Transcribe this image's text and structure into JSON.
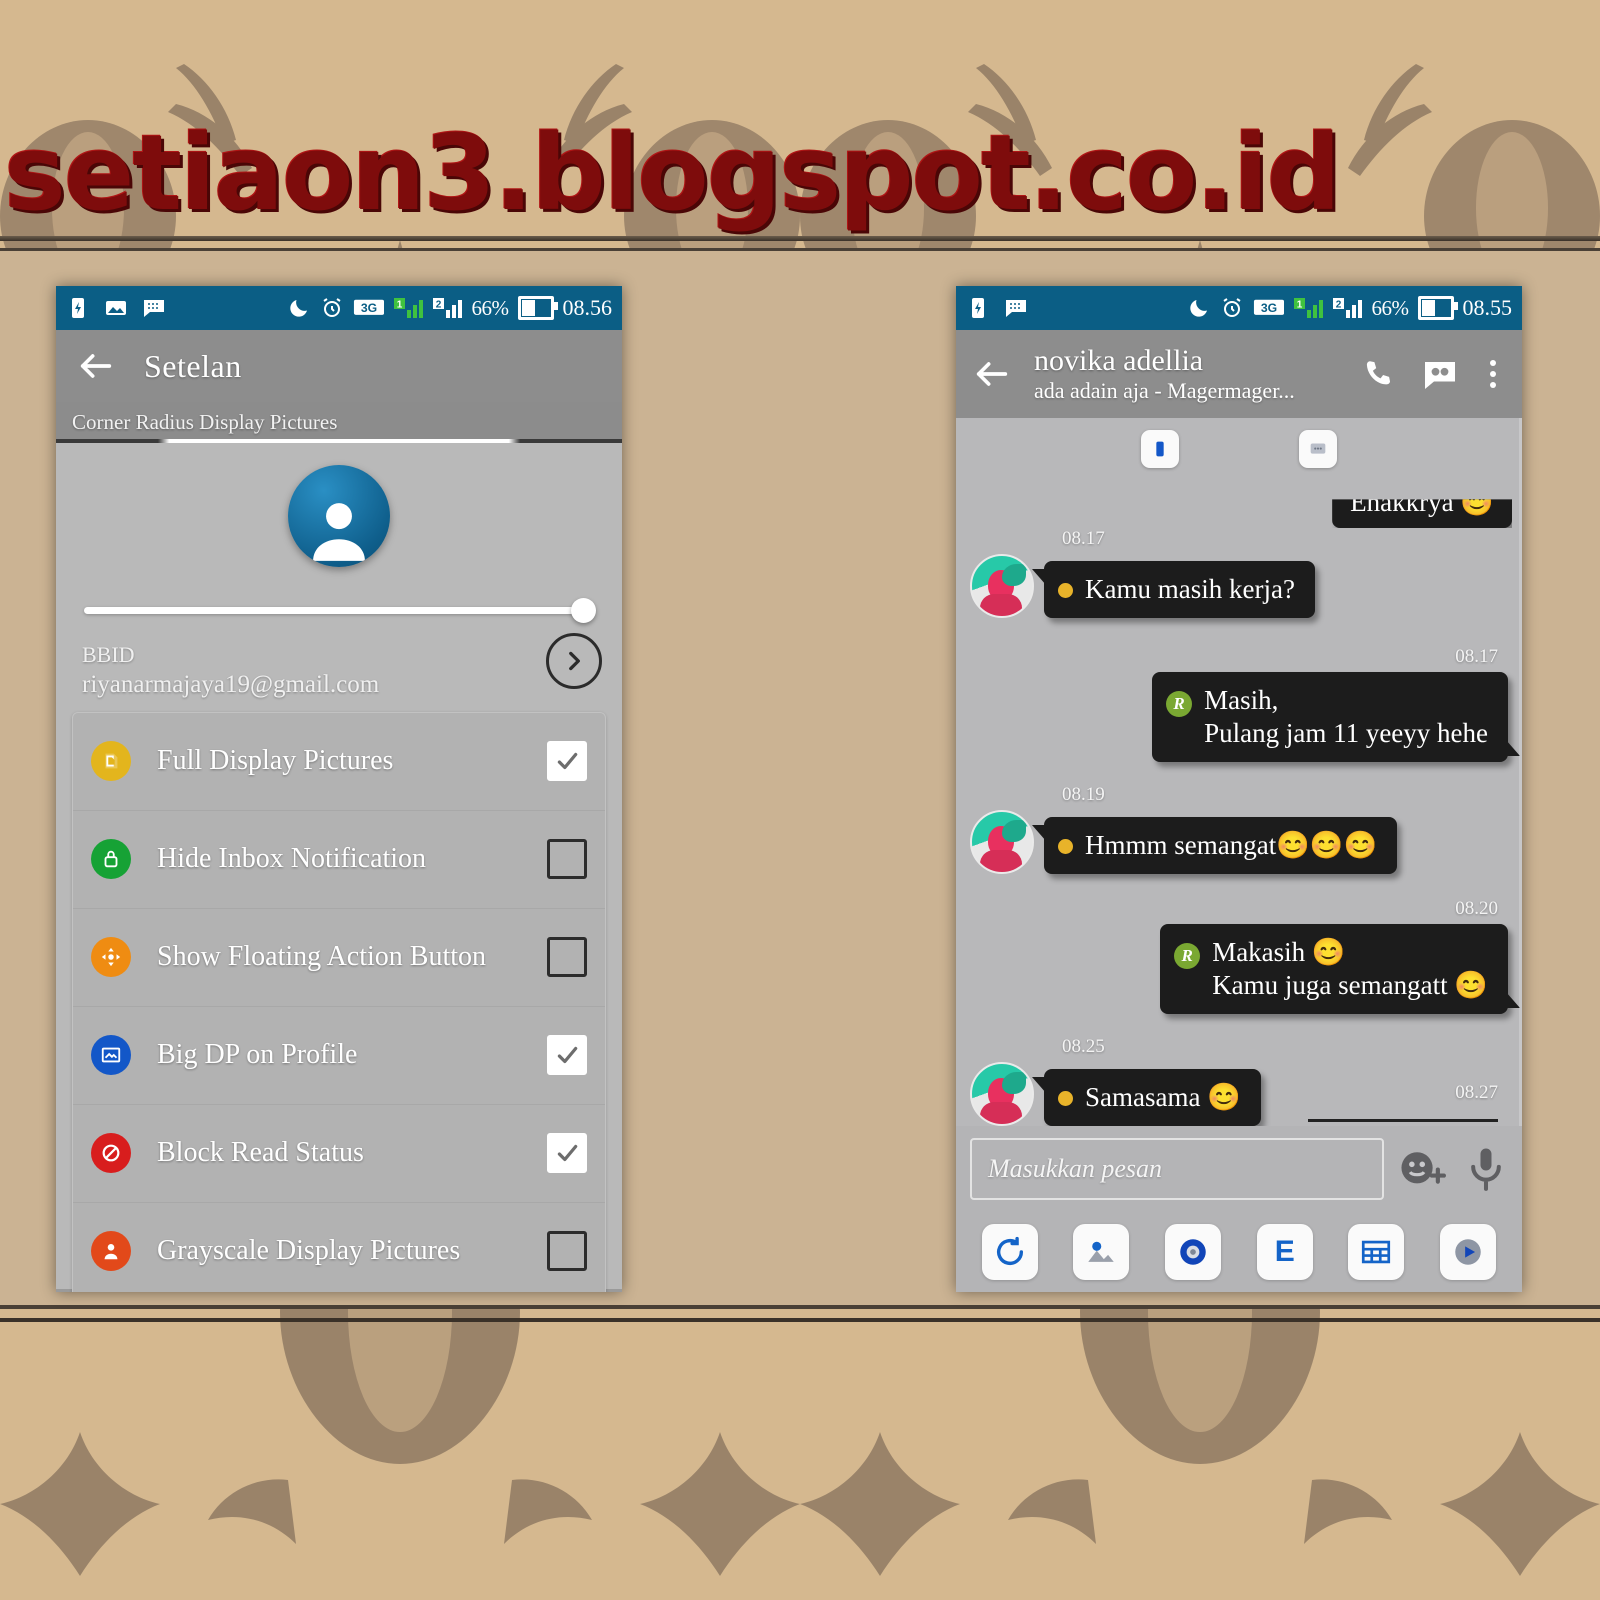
{
  "watermark": {
    "text": "setiaon3.blogspot.co.id"
  },
  "colors": {
    "wallpaper_bg": "#d5b88f",
    "wallpaper_motif": "#968069",
    "band": "#cbb393",
    "statusbar": "#0b5e85",
    "appbar": "#8d8d8d",
    "panel": "#b9b9b9",
    "bubble": "#1c1c1c",
    "accent_blue": "#1464c8",
    "watermark_red": "#7e0c0c"
  },
  "left_phone": {
    "statusbar": {
      "left_icons": [
        "battery-charging-icon",
        "photo-icon",
        "bbm-icon"
      ],
      "right_icons": [
        "moon-icon",
        "alarm-icon"
      ],
      "network": "3G",
      "sim1": "1",
      "sim2": "2",
      "battery_percent": "66%",
      "clock": "08.56"
    },
    "appbar": {
      "back_icon": "back-arrow-icon",
      "title": "Setelan"
    },
    "section": {
      "label": "Corner Radius Display Pictures"
    },
    "slider": {
      "value": 100
    },
    "account": {
      "label": "BBID",
      "email": "riyanarmajaya19@gmail.com",
      "chevron_icon": "chevron-right-icon"
    },
    "settings": [
      {
        "label": "Full Display Pictures",
        "checked": true,
        "icon": "image-crop-icon",
        "icon_color": "#e3b51d"
      },
      {
        "label": "Hide Inbox Notification",
        "checked": false,
        "icon": "lock-icon",
        "icon_color": "#16a235"
      },
      {
        "label": "Show Floating Action Button",
        "checked": false,
        "icon": "move-icon",
        "icon_color": "#ef8c12"
      },
      {
        "label": "Big DP on Profile",
        "checked": true,
        "icon": "picture-frame-icon",
        "icon_color": "#1357c8"
      },
      {
        "label": "Block Read Status",
        "checked": true,
        "icon": "block-icon",
        "icon_color": "#d81d1d"
      },
      {
        "label": "Grayscale Display Pictures",
        "checked": false,
        "icon": "person-icon",
        "icon_color": "#e2491a"
      }
    ]
  },
  "right_phone": {
    "statusbar": {
      "left_icons": [
        "battery-charging-icon",
        "bbm-icon"
      ],
      "right_icons": [
        "moon-icon",
        "alarm-icon"
      ],
      "network": "3G",
      "sim1": "1",
      "sim2": "2",
      "battery_percent": "66%",
      "clock": "08.55"
    },
    "appbar": {
      "back_icon": "back-arrow-icon",
      "name": "novika adellia",
      "status": "ada adain aja - Magermager...",
      "actions": [
        "phone-icon",
        "chat-icon",
        "overflow-menu-icon"
      ]
    },
    "float_icons": [
      "phone-badge-icon",
      "message-badge-icon"
    ],
    "partial_message": {
      "text": "Enakkrya 😊"
    },
    "messages": [
      {
        "dir": "in",
        "time": "08.17",
        "text": "Kamu masih kerja?"
      },
      {
        "dir": "out",
        "time": "08.17",
        "text": "Masih,\nPulang jam 11 yeeyy hehe",
        "badge": "R"
      },
      {
        "dir": "in",
        "time": "08.19",
        "text": "Hmmm semangat😊😊😊"
      },
      {
        "dir": "out",
        "time": "08.20",
        "text": "Makasih 😊\nKamu juga semangatt 😊",
        "badge": "R"
      },
      {
        "dir": "in",
        "time": "08.25",
        "text": "Samasama 😊"
      }
    ],
    "pending_time": "08.27",
    "input": {
      "placeholder": "Masukkan pesan",
      "emoji_icon": "emoji-add-icon",
      "mic_icon": "microphone-icon"
    },
    "toolbar": [
      {
        "icon": "refresh-icon",
        "label": ""
      },
      {
        "icon": "photo-icon",
        "label": ""
      },
      {
        "icon": "camera-icon",
        "label": ""
      },
      {
        "icon": "letter-e-icon",
        "label": "E"
      },
      {
        "icon": "grid-icon",
        "label": ""
      },
      {
        "icon": "play-icon",
        "label": ""
      }
    ]
  }
}
